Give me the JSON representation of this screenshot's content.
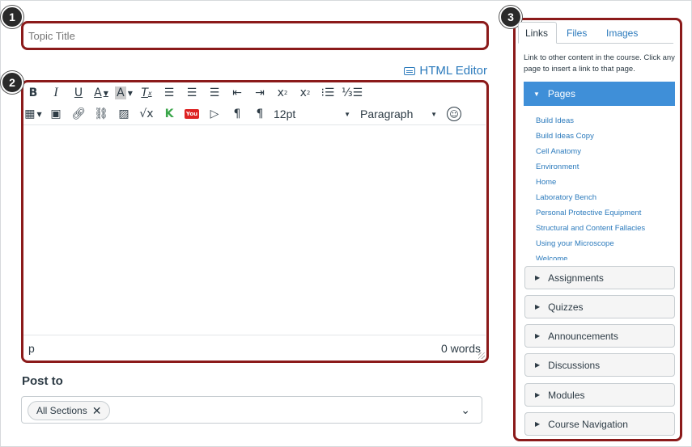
{
  "topic_title": {
    "placeholder": "Topic Title"
  },
  "html_editor_label": "HTML Editor",
  "toolbar": {
    "row1": [
      {
        "name": "bold-button",
        "glyph": "B"
      },
      {
        "name": "italic-button",
        "glyph": "I"
      },
      {
        "name": "underline-button",
        "glyph": "U"
      },
      {
        "name": "text-color-button",
        "glyph": "A"
      },
      {
        "name": "background-color-button",
        "glyph": "A"
      },
      {
        "name": "clear-formatting-button",
        "glyph": "Tx"
      },
      {
        "name": "align-left-button",
        "glyph": "≡"
      },
      {
        "name": "align-center-button",
        "glyph": "≡"
      },
      {
        "name": "align-right-button",
        "glyph": "≡"
      },
      {
        "name": "outdent-button",
        "glyph": "⇤"
      },
      {
        "name": "indent-button",
        "glyph": "⇥"
      },
      {
        "name": "superscript-button",
        "glyph": "x²"
      },
      {
        "name": "subscript-button",
        "glyph": "x₂"
      },
      {
        "name": "bullet-list-button",
        "glyph": "☰"
      },
      {
        "name": "numbered-list-button",
        "glyph": "☷"
      }
    ],
    "font_size": "12pt",
    "block_format": "Paragraph"
  },
  "status": {
    "path": "p",
    "word_count": "0 words"
  },
  "post_to": {
    "label": "Post to",
    "selected_chip": "All Sections"
  },
  "sidebar": {
    "tabs": [
      "Links",
      "Files",
      "Images"
    ],
    "description": "Link to other content in the course. Click any page to insert a link to that page.",
    "active_section": "Pages",
    "pages": [
      "Build Ideas",
      "Build Ideas Copy",
      "Cell Anatomy",
      "Environment",
      "Home",
      "Laboratory Bench",
      "Personal Protective Equipment",
      "Structural and Content Fallacies",
      "Using your Microscope",
      "Welcome"
    ],
    "sections": [
      "Assignments",
      "Quizzes",
      "Announcements",
      "Discussions",
      "Modules",
      "Course Navigation"
    ]
  },
  "callouts": [
    "1",
    "2",
    "3"
  ],
  "colors": {
    "callout_border": "#8b1a1a",
    "link": "#2b7abc",
    "active_section": "#3f8fd8"
  }
}
